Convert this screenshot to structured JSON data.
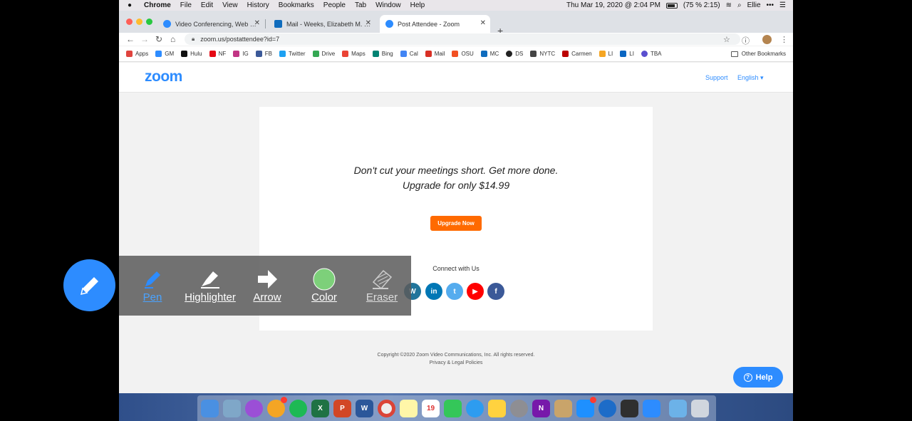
{
  "menubar": {
    "app_name": "Chrome",
    "items": [
      "File",
      "Edit",
      "View",
      "History",
      "Bookmarks",
      "People",
      "Tab",
      "Window",
      "Help"
    ],
    "datetime": "Thu Mar 19, 2020 @ 2:04 PM",
    "battery": "(75 % 2:15)",
    "user": "Ellie"
  },
  "tabs": [
    {
      "title": "Video Conferencing, Web Confe",
      "active": false
    },
    {
      "title": "Mail - Weeks, Elizabeth M. - Outl",
      "active": false
    },
    {
      "title": "Post Attendee - Zoom",
      "active": true
    }
  ],
  "address_bar": {
    "url": "zoom.us/postattendee?id=7"
  },
  "bookmarks": {
    "items": [
      "Apps",
      "GM",
      "Hulu",
      "NF",
      "IG",
      "FB",
      "Twitter",
      "Drive",
      "Maps",
      "Bing",
      "Cal",
      "Mail",
      "OSU",
      "MC",
      "DS",
      "NYTC",
      "Carmen",
      "LI",
      "LI",
      "TBA"
    ],
    "other": "Other Bookmarks"
  },
  "zoom_page": {
    "logo": "zoom",
    "support": "Support",
    "language": "English ▾",
    "promo_line1": "Don't cut your meetings short. Get more done.",
    "promo_line2": "Upgrade for only $14.99",
    "upgrade_button": "Upgrade Now",
    "connect_heading": "Connect with Us",
    "copyright": "Copyright ©2020 Zoom Video Communications, Inc. All rights reserved.",
    "privacy": "Privacy & Legal Policies",
    "help_button": "Help"
  },
  "annotation_toolbar": {
    "tools": [
      "Pen",
      "Highlighter",
      "Arrow",
      "Color",
      "Eraser"
    ]
  },
  "colors": {
    "zoom_blue": "#2d8cff",
    "upgrade_orange": "#ff6a00",
    "annotation_color": "#7dd07a"
  }
}
